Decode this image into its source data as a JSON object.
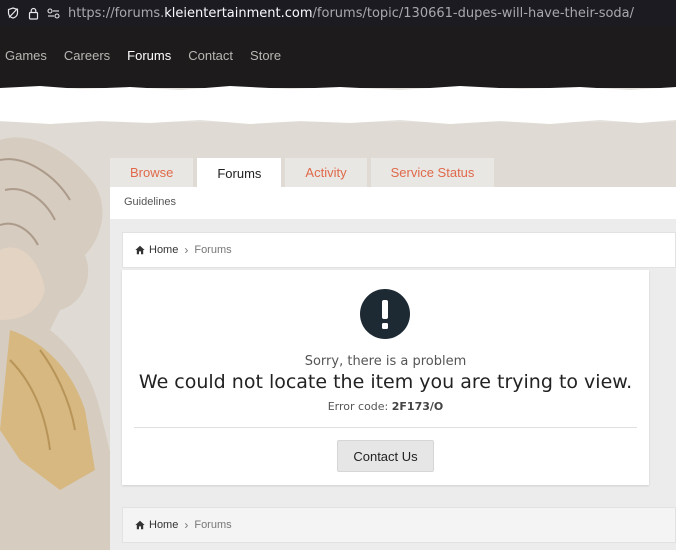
{
  "browser": {
    "url_prefix": "https://forums.",
    "url_host": "kleientertainment.com",
    "url_path": "/forums/topic/130661-dupes-will-have-their-soda/"
  },
  "site_nav": {
    "items": [
      {
        "label": "Games"
      },
      {
        "label": "Careers"
      },
      {
        "label": "Forums",
        "active": true
      },
      {
        "label": "Contact"
      },
      {
        "label": "Store"
      }
    ]
  },
  "tabs": {
    "items": [
      {
        "label": "Browse"
      },
      {
        "label": "Forums",
        "active": true
      },
      {
        "label": "Activity"
      },
      {
        "label": "Service Status"
      }
    ],
    "sub_link": "Guidelines"
  },
  "breadcrumb": {
    "home": "Home",
    "current": "Forums"
  },
  "error": {
    "sorry": "Sorry, there is a problem",
    "headline": "We could not locate the item you are trying to view.",
    "code_label": "Error code:",
    "code": "2F173/O",
    "button": "Contact Us"
  },
  "colors": {
    "tab_link": "#e0694a",
    "nav_bg": "#1d1b1b",
    "error_icon": "#1e2a33"
  }
}
